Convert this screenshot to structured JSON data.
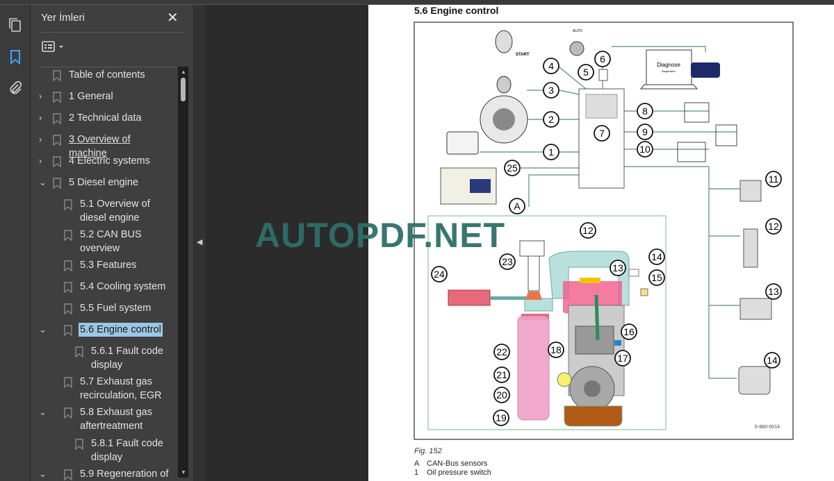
{
  "sidebar": {
    "title": "Yer İmleri",
    "close_icon": "✕",
    "items": [
      {
        "label": "Table of contents",
        "expander": "none",
        "level": 0
      },
      {
        "label": "1 General",
        "expander": "collapsed",
        "level": 0
      },
      {
        "label": "2 Technical data",
        "expander": "collapsed",
        "level": 0
      },
      {
        "label": "3 Overview of machine",
        "expander": "collapsed",
        "level": 0,
        "hovered": true
      },
      {
        "label": "4 Electric systems",
        "expander": "collapsed",
        "level": 0
      },
      {
        "label": "5 Diesel engine",
        "expander": "expanded",
        "level": 0
      },
      {
        "label": "5.1 Overview of diesel engine",
        "expander": "none",
        "level": 1
      },
      {
        "label": "5.2 CAN BUS overview",
        "expander": "none",
        "level": 1
      },
      {
        "label": "5.3 Features",
        "expander": "none",
        "level": 1
      },
      {
        "label": "5.4 Cooling system",
        "expander": "none",
        "level": 1
      },
      {
        "label": "5.5 Fuel system",
        "expander": "none",
        "level": 1
      },
      {
        "label": "5.6 Engine control",
        "expander": "expanded",
        "level": 1,
        "selected": true
      },
      {
        "label": "5.6.1 Fault code display",
        "expander": "none",
        "level": 2
      },
      {
        "label": "5.7 Exhaust gas recirculation, EGR",
        "expander": "none",
        "level": 1
      },
      {
        "label": "5.8 Exhaust gas aftertreatment",
        "expander": "expanded",
        "level": 1
      },
      {
        "label": "5.8.1 Fault code display",
        "expander": "none",
        "level": 2
      },
      {
        "label": "5.9 Regeneration of",
        "expander": "expanded",
        "level": 1
      }
    ]
  },
  "document": {
    "section_title": "5.6   Engine control",
    "watermark": "AUTOPDF.NET",
    "diagram": {
      "callouts": [
        "4",
        "5",
        "6",
        "3",
        "2",
        "8",
        "7",
        "9",
        "1",
        "10",
        "25",
        "A",
        "11",
        "12",
        "12",
        "23",
        "13",
        "14",
        "15",
        "24",
        "13",
        "16",
        "22",
        "18",
        "17",
        "21",
        "20",
        "19",
        "14"
      ],
      "labels": {
        "diagnose": "Diagnose",
        "diagmaster": "Diagmaster",
        "start": "START",
        "auto": "AUTO",
        "code": "S-880-0014"
      }
    },
    "figure_caption": "Fig.  152",
    "legend": [
      {
        "key": "A",
        "text": "CAN-Bus sensors"
      },
      {
        "key": "1",
        "text": "Oil pressure switch"
      }
    ]
  },
  "colors": {
    "accent": "#3ea6ff",
    "selection": "#9cc6e4",
    "watermark": "#2f6f6a"
  }
}
